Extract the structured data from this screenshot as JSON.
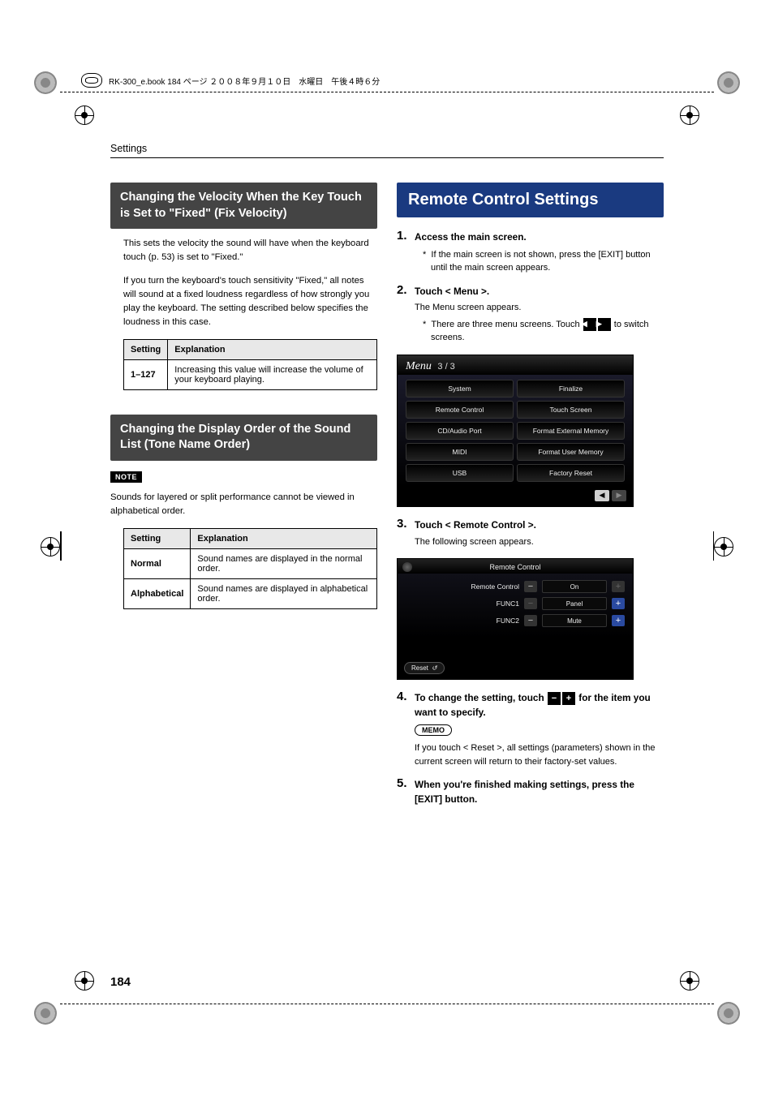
{
  "print_header": "RK-300_e.book  184 ページ  ２００８年９月１０日　水曜日　午後４時６分",
  "running_head": "Settings",
  "page_number": "184",
  "left": {
    "section1": {
      "heading": "Changing the Velocity When the Key Touch is Set to \"Fixed\" (Fix Velocity)",
      "para1": "This sets the velocity the sound will have when the keyboard touch (p. 53) is set to \"Fixed.\"",
      "para2": "If you turn the keyboard's touch sensitivity \"Fixed,\" all notes will sound at a fixed loudness regardless of how strongly you play the keyboard. The setting described below specifies the loudness in this case.",
      "table": {
        "headers": [
          "Setting",
          "Explanation"
        ],
        "rows": [
          {
            "setting": "1–127",
            "explanation": "Increasing this value will increase the volume of your keyboard playing."
          }
        ]
      }
    },
    "section2": {
      "heading": "Changing the Display Order of the Sound List (Tone Name Order)",
      "note_label": "NOTE",
      "note_text": "Sounds for layered or split performance cannot be viewed in alphabetical order.",
      "table": {
        "headers": [
          "Setting",
          "Explanation"
        ],
        "rows": [
          {
            "setting": "Normal",
            "explanation": "Sound names are displayed in the normal order."
          },
          {
            "setting": "Alphabetical",
            "explanation": "Sound names are displayed in alphabetical order."
          }
        ]
      }
    }
  },
  "right": {
    "h1": "Remote Control Settings",
    "steps": [
      {
        "head": "Access the main screen.",
        "star": "If the main screen is not shown, press the [EXIT] button until the main screen appears."
      },
      {
        "head": "Touch < Menu >.",
        "sub": "The Menu screen appears.",
        "star_prefix": "There are three menu screens. Touch ",
        "star_suffix": " to switch screens."
      },
      {
        "head": "Touch < Remote Control >.",
        "sub": "The following screen appears."
      },
      {
        "head_prefix": "To change the setting, touch ",
        "head_suffix": " for the item you want to specify.",
        "memo_label": "MEMO",
        "memo_text": "If you touch < Reset >, all settings (parameters) shown in the current screen will return to their factory-set values."
      },
      {
        "head": "When you're finished making settings, press the [EXIT] button."
      }
    ],
    "menu_shot": {
      "title": "Menu",
      "page": "3 / 3",
      "items": [
        "System",
        "Finalize",
        "Remote Control",
        "Touch Screen",
        "CD/Audio Port",
        "Format External Memory",
        "MIDI",
        "Format User Memory",
        "USB",
        "Factory Reset"
      ]
    },
    "rc_shot": {
      "title": "Remote Control",
      "rows": [
        {
          "label": "Remote Control",
          "value": "On"
        },
        {
          "label": "FUNC1",
          "value": "Panel"
        },
        {
          "label": "FUNC2",
          "value": "Mute"
        }
      ],
      "reset": "Reset"
    }
  },
  "icons": {
    "left_tri": "◀",
    "right_tri": "▶",
    "minus": "−",
    "plus": "+",
    "star": "*"
  }
}
